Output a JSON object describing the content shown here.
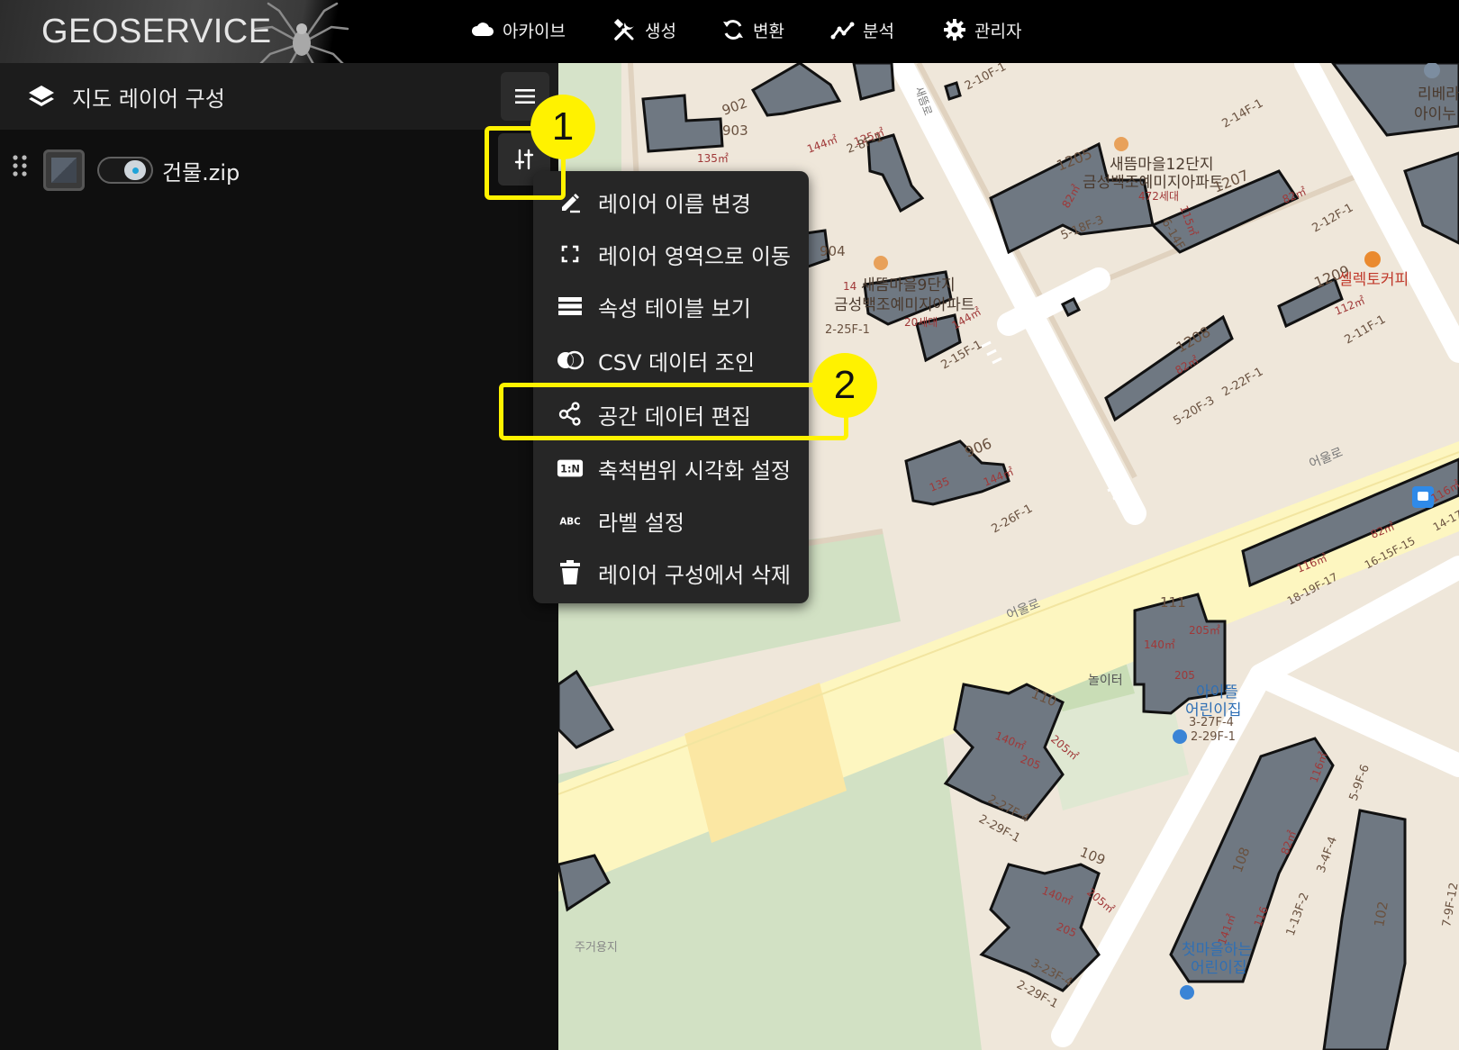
{
  "app": {
    "logo": "GEOSERVICE",
    "nav": [
      {
        "label": "아카이브",
        "icon": "cloud-icon"
      },
      {
        "label": "생성",
        "icon": "tools-icon"
      },
      {
        "label": "변환",
        "icon": "refresh-icon"
      },
      {
        "label": "분석",
        "icon": "analytics-icon"
      },
      {
        "label": "관리자",
        "icon": "gear-icon"
      }
    ]
  },
  "sidebar": {
    "title": "지도 레이어 구성",
    "layers": [
      {
        "name": "건물.zip",
        "visible": true
      }
    ]
  },
  "context_menu": {
    "items": [
      {
        "label": "레이어 이름 변경",
        "icon": "rename-icon"
      },
      {
        "label": "레이어 영역으로 이동",
        "icon": "extent-icon"
      },
      {
        "label": "속성 테이블 보기",
        "icon": "table-icon"
      },
      {
        "label": "CSV 데이터 조인",
        "icon": "join-icon"
      },
      {
        "label": "공간 데이터 편집",
        "icon": "spatial-edit-icon"
      },
      {
        "label": "축척범위 시각화 설정",
        "icon": "scale-range-icon",
        "icon_text": "1:N"
      },
      {
        "label": "라벨 설정",
        "icon": "label-icon",
        "icon_text": "ABC"
      },
      {
        "label": "레이어 구성에서 삭제",
        "icon": "trash-icon"
      }
    ]
  },
  "annotations": {
    "step1": "1",
    "step2": "2",
    "highlight_color": "#fff200"
  },
  "map": {
    "labels": {
      "b902": "902",
      "b903": "903",
      "a144a": "144㎡",
      "a125": "125㎡",
      "a135": "135㎡",
      "p28f1": "2-8F-1",
      "p210f": "2-10F-1",
      "road_saetteum": "새뜸로",
      "b1205": "1205",
      "apt12a": "새뜸마을12단지",
      "apt12b": "금성백조예미지아파트",
      "h472": "472세대",
      "b1207": "1207",
      "a82a": "82㎡",
      "a82b": "82㎡",
      "a115": "115㎡",
      "p518f3": "5-18F-3",
      "p614f": "6-14F",
      "p212f1": "2-12F-1",
      "p214f1": "2-14F-1",
      "b904": "904",
      "apt9a": "새뜸마을9단지",
      "apt9b": "금성백조예미지아파트",
      "h20": "20세대",
      "a144b": "144㎡",
      "a14": "14",
      "p225f1": "2-25F-1",
      "p215f1": "2-15F-1",
      "b1208": "1208",
      "a82c": "82㎡",
      "p520f3": "5-20F-3",
      "p222f1": "2-22F-1",
      "b1209": "1209",
      "a112": "112㎡",
      "cafe": "셀렉토커피",
      "p211f1": "2-11F-1",
      "ribera1": "리베라",
      "ribera2": "아이누",
      "b906": "906",
      "a135b": "135",
      "a144c": "144㎡",
      "p226f1": "2-26F-1",
      "road_eoullim1": "어울로",
      "road_eoullim2": "어울로",
      "a116a": "116㎡",
      "a82d": "82㎡",
      "a116b": "116㎡",
      "p1819f17": "18-19F-17",
      "p1615f15": "16-15F-15",
      "p1417": "14-17",
      "b111": "111",
      "a140a": "140㎡",
      "a205a": "205㎡",
      "a205b": "205",
      "ddl1": "아이뜰",
      "ddl2": "어린이집",
      "p327f4": "3-27F-4",
      "p229f1a": "2-29F-1",
      "playground": "놀이터",
      "b110": "110",
      "a140b": "140㎡",
      "a205c": "205",
      "a205d": "205㎡",
      "p27f4": "2-27F-4",
      "p229f1b": "2-29F-1",
      "b109": "109",
      "a140c": "140㎡",
      "a205e": "205",
      "a205f": "205㎡",
      "p23f4": "3-23F-4",
      "p229f1c": "2-29F-1",
      "b108": "108",
      "a141": "141㎡",
      "a116c": "116",
      "a82e": "82㎡",
      "a116d": "116㎡",
      "p113f2": "1-13F-2",
      "p34f4": "3-4F-4",
      "p59f6": "5-9F-6",
      "firstkids1": "첫마을하는",
      "firstkids2": "어린이집",
      "b102": "102",
      "p79f12": "7-9F-12",
      "zone": "주거용지"
    }
  }
}
